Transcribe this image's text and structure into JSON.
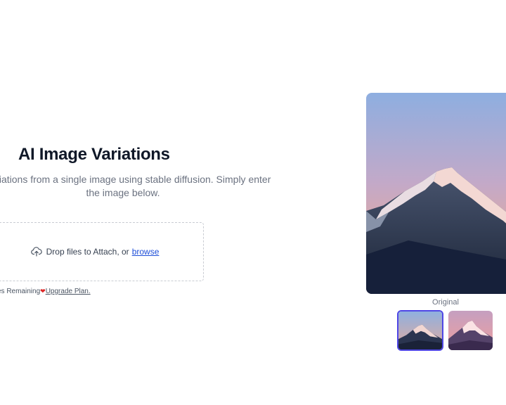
{
  "header": {
    "title": "AI Image Variations",
    "subtitle": "le variations from a single image using stable diffusion. Simply enter the image below."
  },
  "upload": {
    "icon": "cloud-upload-icon",
    "prompt": "Drop files to Attach, or",
    "browse_label": "browse"
  },
  "credits": {
    "remaining_text": "es Remaining",
    "heart": "❤",
    "upgrade_label": "Upgrade Plan."
  },
  "preview": {
    "caption": "Original",
    "image_subject": "snow-capped mountain peak at sunset",
    "thumbnails": [
      {
        "name": "original",
        "selected": true
      },
      {
        "name": "variation-1",
        "selected": false
      }
    ]
  },
  "colors": {
    "accent": "#4f46e5",
    "link": "#1d4ed8",
    "heart": "#dc2626",
    "title": "#101828",
    "muted": "#6b7280"
  }
}
